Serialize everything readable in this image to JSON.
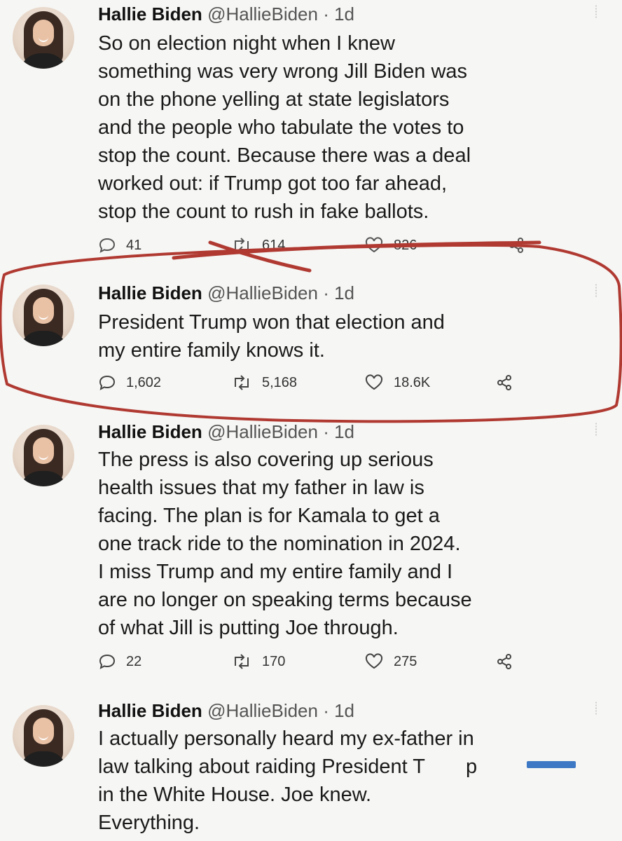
{
  "colors": {
    "background": "#f6f6f4",
    "text": "#1a1a1a",
    "handle": "#555555",
    "annotation_ink": "#b03a32",
    "censor_bar": "#3d78c4"
  },
  "tweets": [
    {
      "name": "Hallie Biden",
      "handle": "@HallieBiden",
      "time": "· 1d",
      "lines": [
        "So on election night when I knew",
        "something was very wrong Jill Biden was",
        "on the phone yelling at state legislators",
        "and the people who tabulate the votes to",
        "stop the count. Because there was a deal",
        "worked out: if Trump got too far ahead,",
        "stop the count to rush in fake ballots."
      ],
      "replies": "41",
      "retweets": "614",
      "likes": "826"
    },
    {
      "name": "Hallie Biden",
      "handle": "@HallieBiden",
      "time": "· 1d",
      "lines": [
        "President Trump won that election and",
        "my entire family knows it."
      ],
      "replies": "1,602",
      "retweets": "5,168",
      "likes": "18.6K"
    },
    {
      "name": "Hallie Biden",
      "handle": "@HallieBiden",
      "time": "· 1d",
      "lines": [
        "The press is also covering up serious",
        "health issues that my father in law is",
        "facing. The plan is for Kamala to get a",
        "one track ride to the nomination in 2024.",
        "I miss Trump and my entire family and I",
        "are no longer on speaking terms because",
        "of what Jill is putting Joe through."
      ],
      "replies": "22",
      "retweets": "170",
      "likes": "275"
    },
    {
      "name": "Hallie Biden",
      "handle": "@HallieBiden",
      "time": "· 1d",
      "lines": [
        "I actually personally heard my ex-father in",
        "law talking about raiding President T",
        "in the White House. Joe knew.",
        "Everything."
      ]
    }
  ],
  "tweet4_line2_tail": "p"
}
